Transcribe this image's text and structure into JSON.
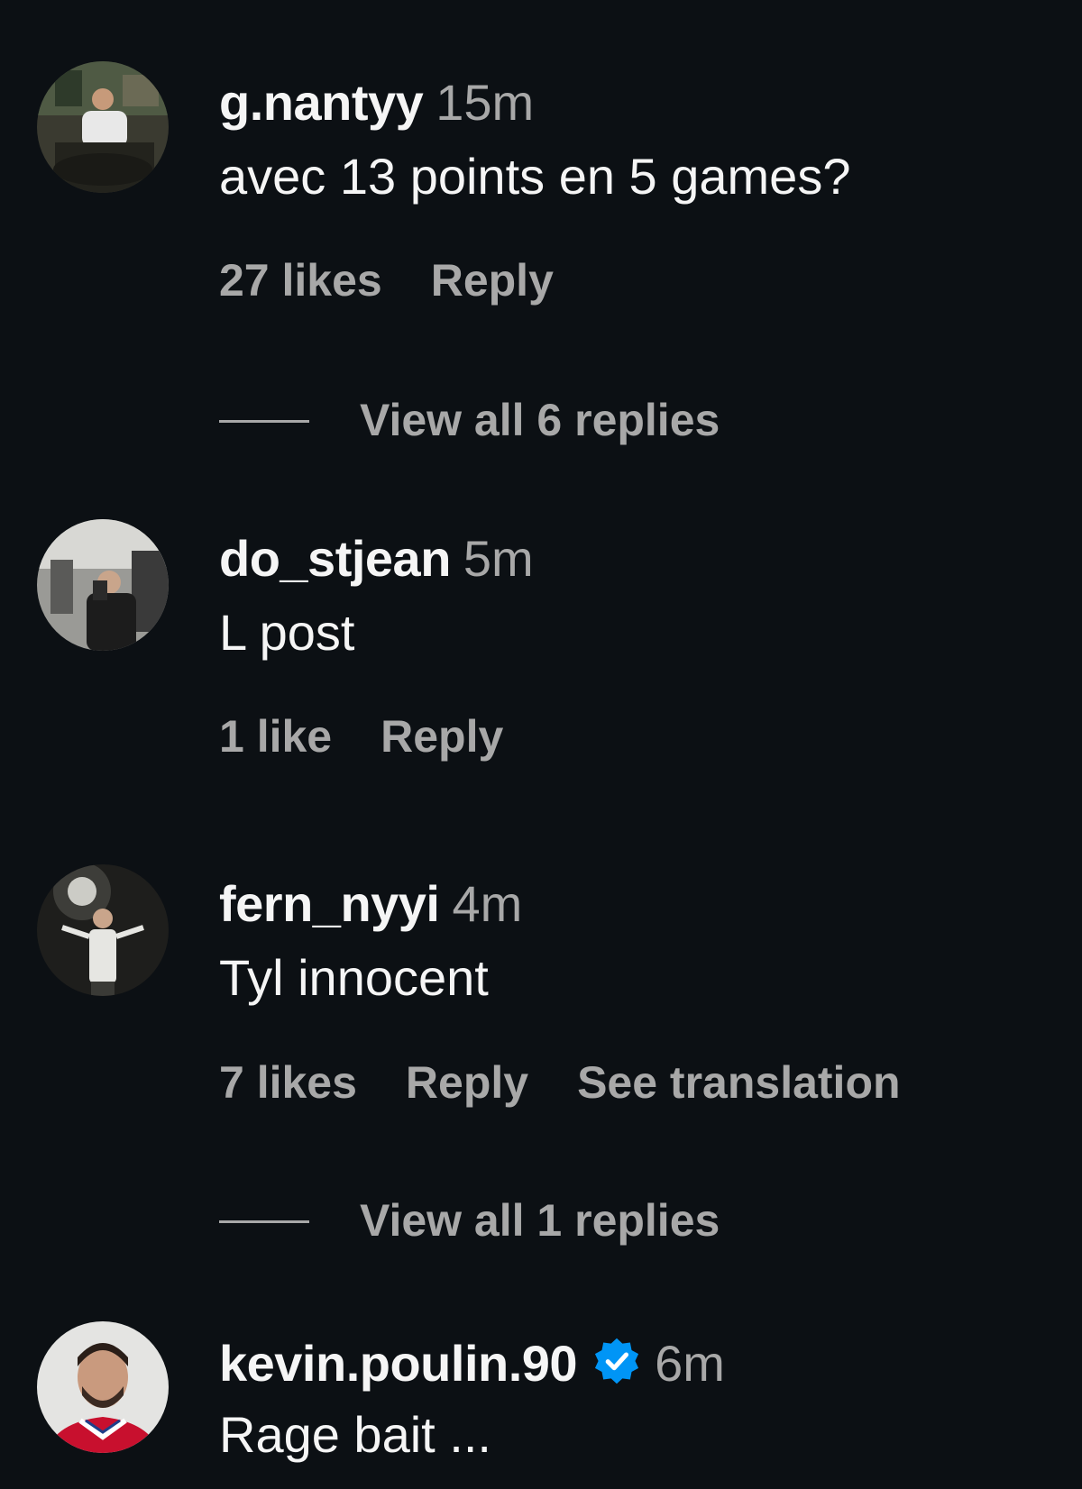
{
  "comments": [
    {
      "username": "g.nantyy",
      "time": "15m",
      "text": "avec 13 points en 5 games?",
      "likes": "27 likes",
      "reply": "Reply",
      "view_replies": "View all 6 replies"
    },
    {
      "username": "do_stjean",
      "time": "5m",
      "text": "L post",
      "likes": "1 like",
      "reply": "Reply"
    },
    {
      "username": "fern_nyyi",
      "time": "4m",
      "text": "Tyl innocent",
      "likes": "7 likes",
      "reply": "Reply",
      "see_translation": "See translation",
      "view_replies": "View all 1 replies"
    },
    {
      "username": "kevin.poulin.90",
      "verified": true,
      "time": "6m",
      "text": "Rage bait ..."
    }
  ],
  "colors": {
    "background": "#0c1014",
    "primary_text": "#f5f5f5",
    "secondary_text": "#a8a8a8",
    "verified_badge": "#0095f6"
  },
  "icons": [
    "verified-badge-icon"
  ]
}
